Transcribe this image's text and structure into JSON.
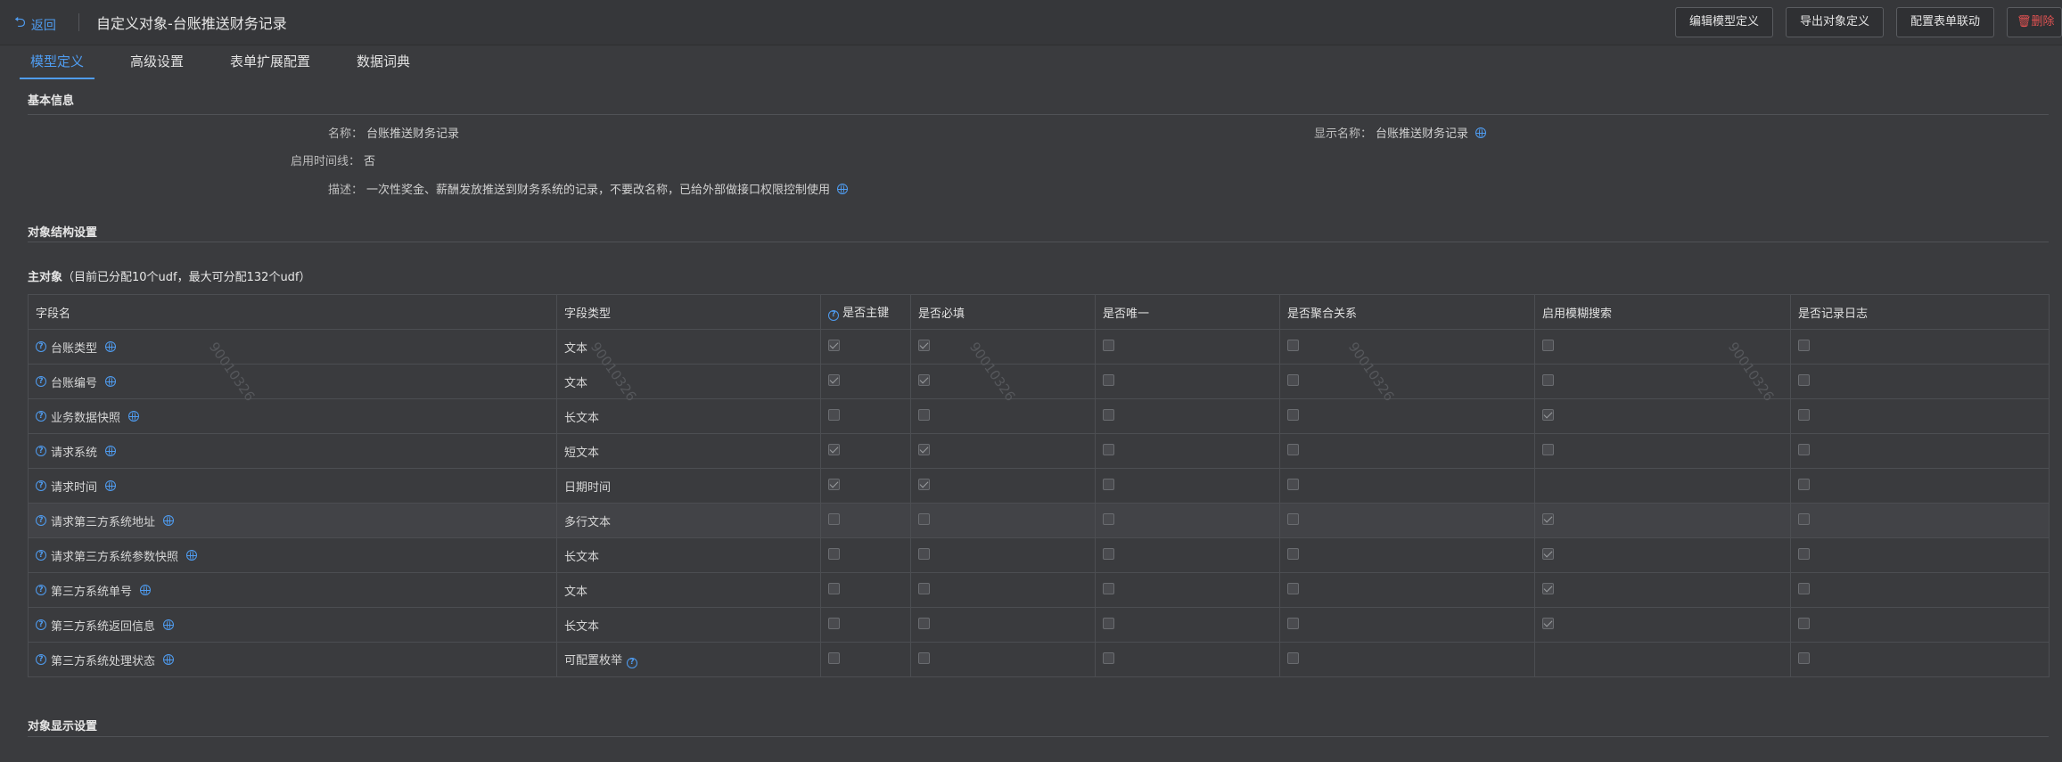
{
  "header": {
    "back_label": "返回",
    "title": "自定义对象-台账推送财务记录",
    "buttons": [
      "编辑模型定义",
      "导出对象定义",
      "配置表单联动",
      "删除"
    ]
  },
  "tabs": [
    "模型定义",
    "高级设置",
    "表单扩展配置",
    "数据词典"
  ],
  "basic": {
    "title": "基本信息",
    "name_label": "名称：",
    "name_value": "台账推送财务记录",
    "display_label": "显示名称：",
    "display_value": "台账推送财务记录",
    "timeline_label": "启用时间线：",
    "timeline_value": "否",
    "desc_label": "描述：",
    "desc_value": "一次性奖金、薪酬发放推送到财务系统的记录，不要改名称，已给外部做接口权限控制使用"
  },
  "structure": {
    "title": "对象结构设置",
    "main_label": "主对象",
    "main_note": "（目前已分配10个udf，最大可分配132个udf）"
  },
  "table": {
    "columns": [
      "字段名",
      "字段类型",
      "是否主键",
      "是否必填",
      "是否唯一",
      "是否聚合关系",
      "启用模糊搜索",
      "是否记录日志"
    ],
    "rows": [
      {
        "name": "台账类型",
        "type": "文本",
        "pk": true,
        "req": true,
        "uniq": false,
        "agg": false,
        "fuzzy": "off",
        "log": false
      },
      {
        "name": "台账编号",
        "type": "文本",
        "pk": true,
        "req": true,
        "uniq": false,
        "agg": false,
        "fuzzy": "off",
        "log": false
      },
      {
        "name": "业务数据快照",
        "type": "长文本",
        "pk": false,
        "req": false,
        "uniq": false,
        "agg": false,
        "fuzzy": "on",
        "log": false
      },
      {
        "name": "请求系统",
        "type": "短文本",
        "pk": true,
        "req": true,
        "uniq": false,
        "agg": false,
        "fuzzy": "off",
        "log": false
      },
      {
        "name": "请求时间",
        "type": "日期时间",
        "pk": true,
        "req": true,
        "uniq": false,
        "agg": false,
        "fuzzy": "none",
        "log": false
      },
      {
        "name": "请求第三方系统地址",
        "type": "多行文本",
        "pk": false,
        "req": false,
        "uniq": false,
        "agg": false,
        "fuzzy": "on",
        "log": false
      },
      {
        "name": "请求第三方系统参数快照",
        "type": "长文本",
        "pk": false,
        "req": false,
        "uniq": false,
        "agg": false,
        "fuzzy": "on",
        "log": false
      },
      {
        "name": "第三方系统单号",
        "type": "文本",
        "pk": false,
        "req": false,
        "uniq": false,
        "agg": false,
        "fuzzy": "on",
        "log": false
      },
      {
        "name": "第三方系统返回信息",
        "type": "长文本",
        "pk": false,
        "req": false,
        "uniq": false,
        "agg": false,
        "fuzzy": "on",
        "log": false
      },
      {
        "name": "第三方系统处理状态",
        "type": "可配置枚举",
        "pk": false,
        "req": false,
        "uniq": false,
        "agg": false,
        "fuzzy": "none",
        "log": false
      }
    ]
  },
  "display": {
    "title": "对象显示设置"
  },
  "watermark": "90010326",
  "colors": {
    "accent": "#4f9cf0",
    "danger": "#e05252",
    "background": "#3a3b3e"
  }
}
